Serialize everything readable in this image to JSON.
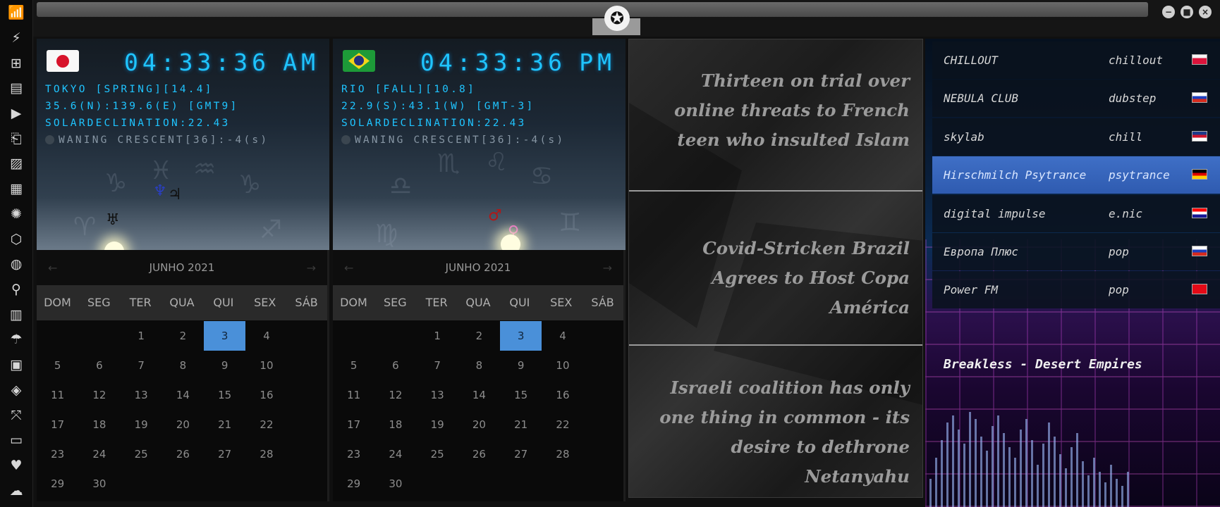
{
  "sidebar": {
    "icons": [
      "wifi-icon",
      "flash-icon",
      "windows-icon",
      "archive-icon",
      "play-icon",
      "map-book-icon",
      "image-icon",
      "news-icon",
      "settings-gear-icon",
      "hexagon-icon",
      "globe-icon",
      "search-icon",
      "map-icon",
      "umbrella-icon",
      "contacts-icon",
      "diamond-icon",
      "expand-icon",
      "youtube-icon",
      "heart-icon",
      "cloud-icon"
    ],
    "glyphs": [
      "📶",
      "⚡",
      "⊞",
      "▤",
      "▶",
      "⎗",
      "▨",
      "▦",
      "✺",
      "⬡",
      "◍",
      "⚲",
      "▥",
      "☂",
      "▣",
      "◈",
      "⤧",
      "▭",
      "♥",
      "☁"
    ]
  },
  "window": {
    "logo_glyph": "✪",
    "buttons": {
      "minimize": "−",
      "maximize": "■",
      "close": "×"
    }
  },
  "clocks": [
    {
      "time": "04:33:36",
      "ampm": "AM",
      "line1": "TOKYO [SPRING][14.4]",
      "line2": "35.6(N):139.6(E) [GMT9]",
      "line3": "SOLARDECLINATION:22.43",
      "moon": "WANING CRESCENT[36]:-4(s)"
    },
    {
      "time": "04:33:36",
      "ampm": "PM",
      "line1": "RIO [FALL][10.8]",
      "line2": "22.9(S):43.1(W) [GMT-3]",
      "line3": "SOLARDECLINATION:22.43",
      "moon": "WANING CRESCENT[36]:-4(s)"
    }
  ],
  "calendars": [
    {
      "month": "JUNHO 2021",
      "prev": "←",
      "next": "→",
      "dow": [
        "DOM",
        "SEG",
        "TER",
        "QUA",
        "QUI",
        "SEX",
        "SÁB"
      ],
      "days": [
        "",
        "",
        "1",
        "2",
        "3",
        "4",
        "5",
        "6",
        "7",
        "8",
        "9",
        "10",
        "11",
        "12",
        "13",
        "14",
        "15",
        "16",
        "17",
        "18",
        "19",
        "20",
        "21",
        "22",
        "23",
        "24",
        "25",
        "26",
        "27",
        "28",
        "29",
        "30"
      ],
      "today": "3"
    },
    {
      "month": "JUNHO 2021",
      "prev": "←",
      "next": "→",
      "dow": [
        "DOM",
        "SEG",
        "TER",
        "QUA",
        "QUI",
        "SEX",
        "SÁB"
      ],
      "days": [
        "",
        "",
        "1",
        "2",
        "3",
        "4",
        "5",
        "6",
        "7",
        "8",
        "9",
        "10",
        "11",
        "12",
        "13",
        "14",
        "15",
        "16",
        "17",
        "18",
        "19",
        "20",
        "21",
        "22",
        "23",
        "24",
        "25",
        "26",
        "27",
        "28",
        "29",
        "30"
      ],
      "today": "3"
    }
  ],
  "news": [
    "Thirteen on trial over online threats to French teen who insulted Islam",
    "Covid-Stricken Brazil Agrees to Host Copa América",
    "Israeli coalition has only one thing in common - its desire to dethrone Netanyahu"
  ],
  "radio": {
    "stations": [
      {
        "name": "CHILLOUT",
        "genre": "chillout",
        "flag": "poland-flag",
        "colors": [
          "#f5f5f5",
          "#dc143c"
        ]
      },
      {
        "name": "NEBULA CLUB",
        "genre": "dubstep",
        "flag": "russia-flag",
        "colors": [
          "#ffffff",
          "#1c3fbf",
          "#d52b1e"
        ]
      },
      {
        "name": "skylab",
        "genre": "chill",
        "flag": "uk-flag",
        "colors": [
          "#1e3a8a",
          "#cf142b",
          "#ffffff"
        ]
      },
      {
        "name": "Hirschmilch Psytrance",
        "genre": "psytrance",
        "flag": "germany-flag",
        "colors": [
          "#000000",
          "#dd0000",
          "#ffce00"
        ]
      },
      {
        "name": "digital impulse",
        "genre": "e.nic",
        "flag": "croatia-flag",
        "colors": [
          "#ff0000",
          "#ffffff",
          "#171796"
        ]
      },
      {
        "name": "Европа Плюс",
        "genre": "pop",
        "flag": "russia-flag",
        "colors": [
          "#ffffff",
          "#1c3fbf",
          "#d52b1e"
        ]
      },
      {
        "name": "Power FM",
        "genre": "pop",
        "flag": "turkey-flag",
        "colors": [
          "#e30a17",
          "#e30a17",
          "#e30a17"
        ]
      }
    ],
    "active_index": 3,
    "now_playing": "Breakless - Desert Empires"
  }
}
